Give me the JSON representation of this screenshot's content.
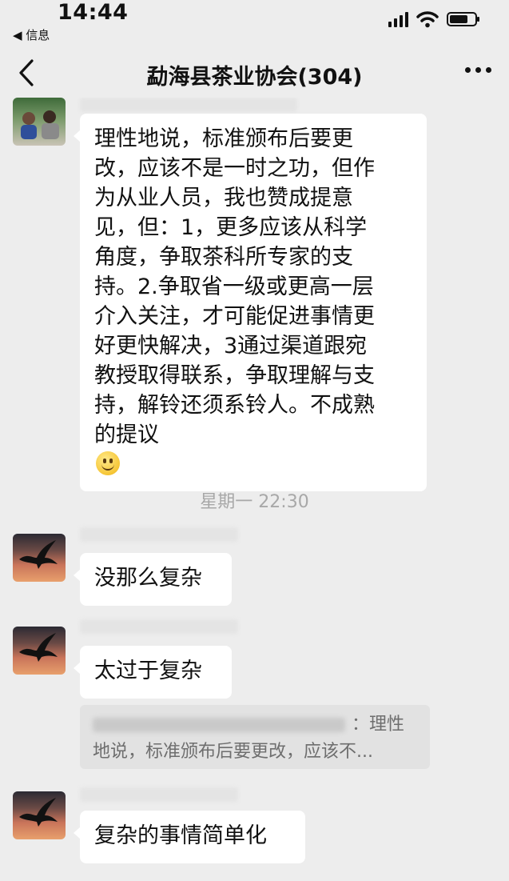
{
  "status_bar": {
    "time": "14:44",
    "back_app": "◀ 信息",
    "icons": [
      "signal-icon",
      "wifi-icon",
      "battery-icon"
    ]
  },
  "nav": {
    "title": "勐海县茶业协会(304)",
    "back_icon": "chevron-left-icon",
    "more_icon": "more-icon"
  },
  "messages": [
    {
      "avatar": "people-photo",
      "text": "理性地说，标准颁布后要更\n改，应该不是一时之功，但作\n为从业人员，我也赞成提意\n见，但：1，更多应该从科学\n角度，争取茶科所专家的支\n持。2.争取省一级或更高一层\n介入关注，才可能促进事情更\n好更快解决，3通过渠道跟宛\n教授取得联系，争取理解与支\n持，解铃还须系铃人。不成熟\n的提议",
      "emoji": "smile-emoji"
    },
    {
      "avatar": "eagle-sunset",
      "text": "没那么复杂"
    },
    {
      "avatar": "eagle-sunset",
      "text": "太过于复杂"
    },
    {
      "avatar": "eagle-sunset",
      "text": "复杂的事情简单化"
    }
  ],
  "timestamp": "星期一 22:30",
  "quote": {
    "line1_suffix": "：理性",
    "line2": "地说，标准颁布后要更改，应该不..."
  },
  "colors": {
    "background": "#ededed",
    "bubble": "#ffffff",
    "quote_bg": "#e2e2e2",
    "timestamp": "#a8a8a8"
  }
}
